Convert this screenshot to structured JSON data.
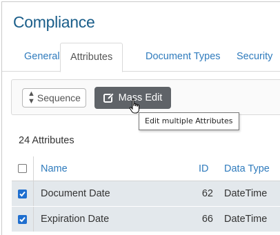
{
  "page": {
    "title": "Compliance"
  },
  "tabs": [
    {
      "label": "General",
      "active": false
    },
    {
      "label": "Attributes",
      "active": true
    },
    {
      "label": "Document Types",
      "active": false
    },
    {
      "label": "Security",
      "active": false
    }
  ],
  "toolbar": {
    "sequence_label": "Sequence",
    "mass_edit_label": "Mass Edit",
    "tooltip": "Edit multiple Attributes"
  },
  "count_label": "24 Attributes",
  "table": {
    "columns": {
      "name": "Name",
      "id": "ID",
      "type": "Data Type"
    },
    "rows": [
      {
        "checked": true,
        "name": "Document Date",
        "id": "62",
        "type": "DateTime"
      },
      {
        "checked": true,
        "name": "Expiration Date",
        "id": "66",
        "type": "DateTime"
      }
    ]
  },
  "colors": {
    "title": "#1a5e8a",
    "link": "#2f7bbd",
    "primary_button": "#5f6368",
    "checkbox": "#1f6fcf",
    "selected_row": "#e3e8ec"
  },
  "icons": {
    "sequence": "sort-icon",
    "mass_edit": "edit-icon",
    "pointer": "hand-cursor-icon"
  }
}
